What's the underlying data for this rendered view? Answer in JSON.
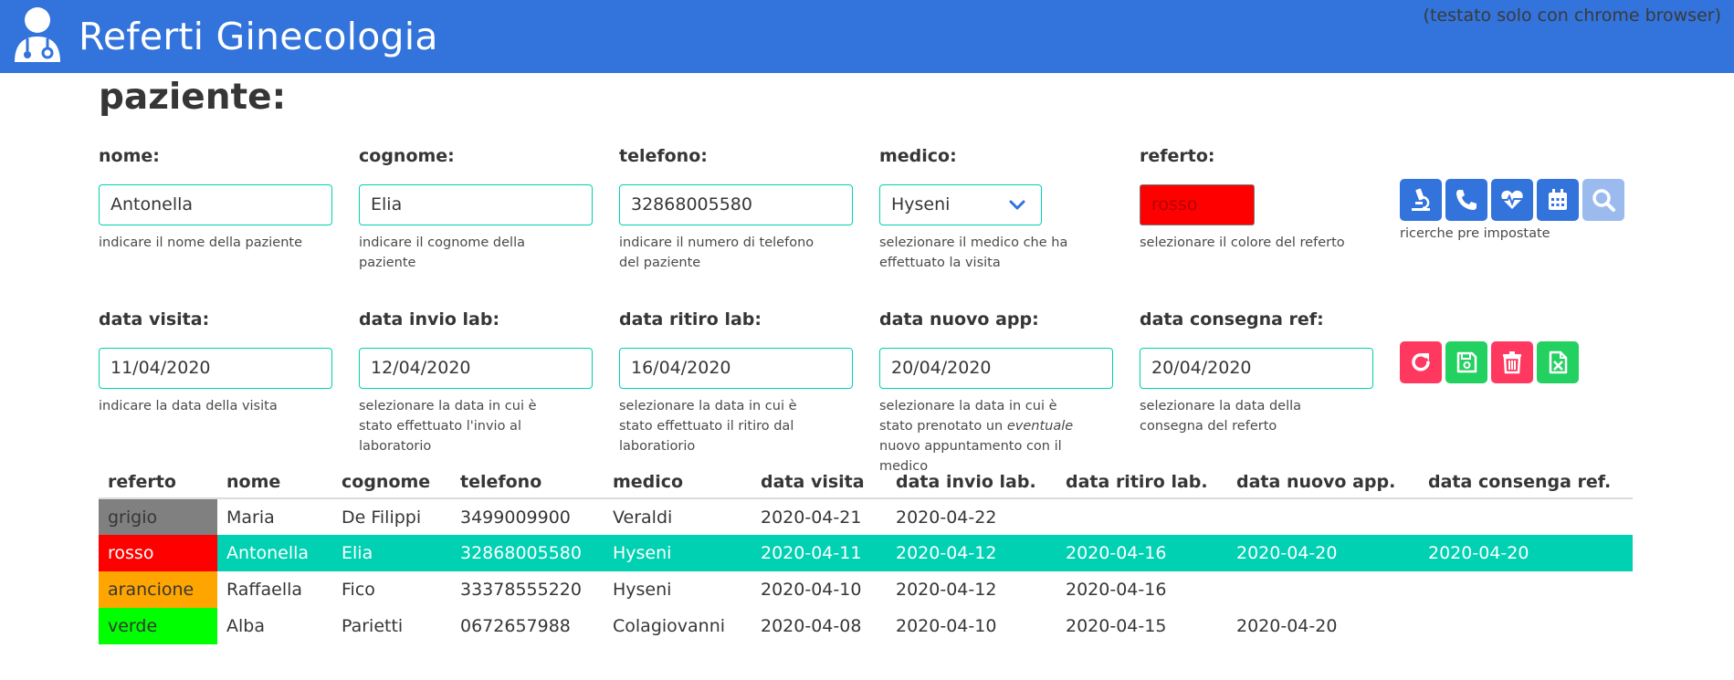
{
  "header": {
    "title": "Referti Ginecologia",
    "note": "(testato solo con chrome browser)"
  },
  "section_title": "paziente:",
  "form": {
    "nome": {
      "label": "nome:",
      "value": "Antonella",
      "help": "indicare il nome della paziente"
    },
    "cognome": {
      "label": "cognome:",
      "value": "Elia",
      "help": "indicare il cognome della paziente"
    },
    "telefono": {
      "label": "telefono:",
      "value": "32868005580",
      "help": "indicare il numero di telefono del paziente"
    },
    "medico": {
      "label": "medico:",
      "value": "Hyseni",
      "help": "selezionare il medico che ha effettuato la visita"
    },
    "referto": {
      "label": "referto:",
      "value": "rosso",
      "color": "#ff0000",
      "help": "selezionare il colore del referto"
    },
    "ricerche_help": "ricerche pre impostate",
    "data_visita": {
      "label": "data visita:",
      "value": "11/04/2020",
      "help": "indicare la data della visita"
    },
    "data_invio_lab": {
      "label": "data invio lab:",
      "value": "12/04/2020",
      "help": "selezionare la data in cui è stato effettuato l'invio al laboratorio"
    },
    "data_ritiro_lab": {
      "label": "data ritiro lab:",
      "value": "16/04/2020",
      "help": "selezionare la data in cui è stato effettuato il ritiro dal laboratiorio"
    },
    "data_nuovo_app": {
      "label": "data nuovo app:",
      "value": "20/04/2020",
      "help_pre": "selezionare la data in cui è stato prenotato un ",
      "help_em": "eventuale",
      "help_post": " nuovo appuntamento con il medico"
    },
    "data_consegna_ref": {
      "label": "data consegna ref:",
      "value": "20/04/2020",
      "help": "selezionare la data della consegna del referto"
    }
  },
  "buttons": {
    "search": [
      "microscope-icon",
      "phone-icon",
      "heartbeat-icon",
      "calendar-icon",
      "search-icon"
    ],
    "actions": [
      "refresh-icon",
      "save-icon",
      "trash-icon",
      "excel-icon"
    ]
  },
  "table": {
    "headers": [
      "referto",
      "nome",
      "cognome",
      "telefono",
      "medico",
      "data visita",
      "data invio lab.",
      "data ritiro lab.",
      "data nuovo app.",
      "data consenga ref."
    ],
    "rows": [
      {
        "referto": "grigio",
        "color": "#808080",
        "nome": "Maria",
        "cognome": "De Filippi",
        "telefono": "3499009900",
        "medico": "Veraldi",
        "data_visita": "2020-04-21",
        "data_invio": "2020-04-22",
        "data_ritiro": "",
        "data_nuovo": "",
        "data_consegna": "",
        "selected": false
      },
      {
        "referto": "rosso",
        "color": "#ff0000",
        "nome": "Antonella",
        "cognome": "Elia",
        "telefono": "32868005580",
        "medico": "Hyseni",
        "data_visita": "2020-04-11",
        "data_invio": "2020-04-12",
        "data_ritiro": "2020-04-16",
        "data_nuovo": "2020-04-20",
        "data_consegna": "2020-04-20",
        "selected": true
      },
      {
        "referto": "arancione",
        "color": "#ffa500",
        "nome": "Raffaella",
        "cognome": "Fico",
        "telefono": "33378555220",
        "medico": "Hyseni",
        "data_visita": "2020-04-10",
        "data_invio": "2020-04-12",
        "data_ritiro": "2020-04-16",
        "data_nuovo": "",
        "data_consegna": "",
        "selected": false
      },
      {
        "referto": "verde",
        "color": "#00ff00",
        "nome": "Alba",
        "cognome": "Parietti",
        "telefono": "0672657988",
        "medico": "Colagiovanni",
        "data_visita": "2020-04-08",
        "data_invio": "2020-04-10",
        "data_ritiro": "2020-04-15",
        "data_nuovo": "2020-04-20",
        "data_consegna": "",
        "selected": false
      }
    ]
  },
  "colors": {
    "primary": "#3273dc",
    "accent": "#00d1b2",
    "danger": "#ff3860",
    "success": "#23d160"
  }
}
